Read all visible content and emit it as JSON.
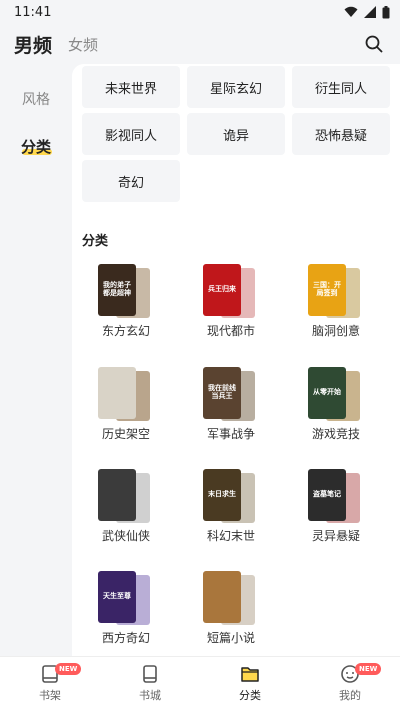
{
  "status": {
    "time": "11:41"
  },
  "header": {
    "tab_male": "男频",
    "tab_female": "女频"
  },
  "sidebar": {
    "items": [
      {
        "label": "风格"
      },
      {
        "label": "分类"
      }
    ]
  },
  "style_chips": [
    {
      "label": "未来世界"
    },
    {
      "label": "星际玄幻"
    },
    {
      "label": "衍生同人"
    },
    {
      "label": "影视同人"
    },
    {
      "label": "诡异"
    },
    {
      "label": "恐怖悬疑"
    },
    {
      "label": "奇幻"
    }
  ],
  "section": {
    "title": "分类"
  },
  "categories": [
    {
      "label": "东方玄幻",
      "cover_text": "我的弟子 都是超神",
      "cover_color": "#3a2a1e",
      "back_color": "#c8b9a6"
    },
    {
      "label": "现代都市",
      "cover_text": "兵王归来",
      "cover_color": "#c0171b",
      "back_color": "#e5b8b8"
    },
    {
      "label": "脑洞创意",
      "cover_text": "三国：开局签到",
      "cover_color": "#e8a314",
      "back_color": "#d9c9a0"
    },
    {
      "label": "历史架空",
      "cover_text": "",
      "cover_color": "#d9d3c7",
      "back_color": "#b9a58c"
    },
    {
      "label": "军事战争",
      "cover_text": "我在前线 当兵王",
      "cover_color": "#5a4330",
      "back_color": "#b8aea0"
    },
    {
      "label": "游戏竞技",
      "cover_text": "从零开始",
      "cover_color": "#2f4a33",
      "back_color": "#c9b48e"
    },
    {
      "label": "武侠仙侠",
      "cover_text": "",
      "cover_color": "#3b3b3b",
      "back_color": "#d0d0d0"
    },
    {
      "label": "科幻末世",
      "cover_text": "末日求生",
      "cover_color": "#4a3a22",
      "back_color": "#c9c2b4"
    },
    {
      "label": "灵异悬疑",
      "cover_text": "盗墓笔记",
      "cover_color": "#2c2c2c",
      "back_color": "#d8a8a8"
    },
    {
      "label": "西方奇幻",
      "cover_text": "天生至尊",
      "cover_color": "#3a2466",
      "back_color": "#b9aed6"
    },
    {
      "label": "短篇小说",
      "cover_text": "",
      "cover_color": "#a9763c",
      "back_color": "#d7cfc4"
    }
  ],
  "bottom_nav": [
    {
      "label": "书架",
      "badge": "NEW",
      "icon": "book-icon"
    },
    {
      "label": "书城",
      "badge": "",
      "icon": "store-icon"
    },
    {
      "label": "分类",
      "badge": "",
      "icon": "folder-icon"
    },
    {
      "label": "我的",
      "badge": "NEW",
      "icon": "profile-icon"
    }
  ],
  "colors": {
    "accent": "#ffd84d",
    "badge": "#ff5b5b",
    "background": "#f4f5f7"
  }
}
